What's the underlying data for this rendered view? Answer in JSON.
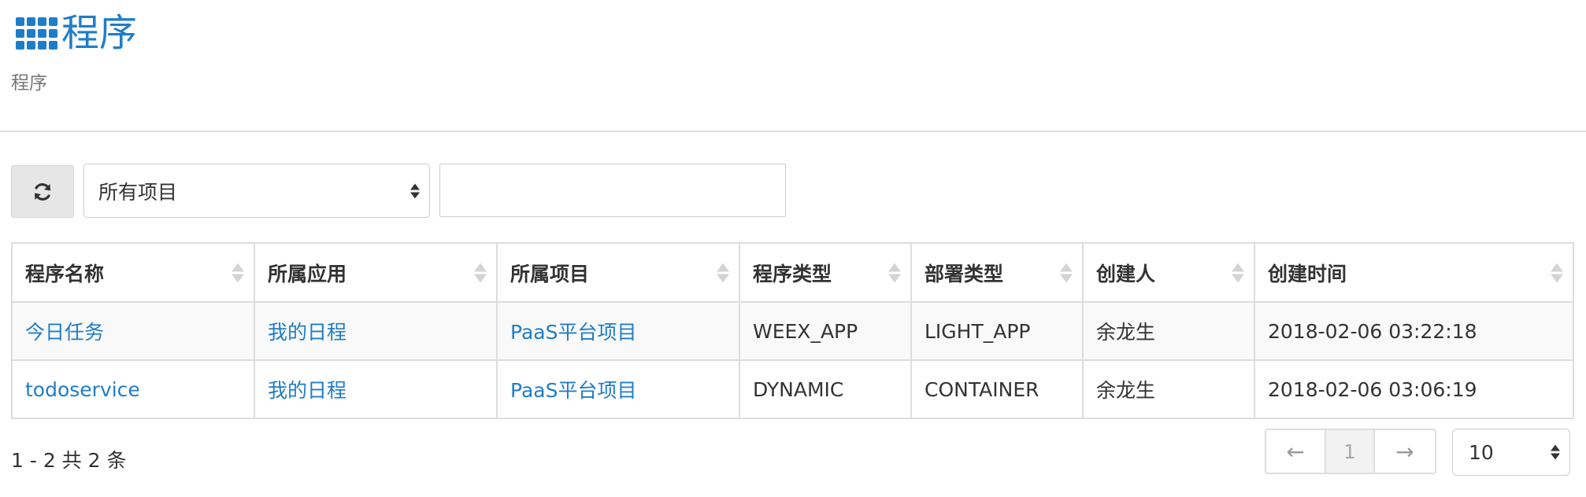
{
  "header": {
    "icon": "grid-icon",
    "title": "程序",
    "subtitle": "程序",
    "accent_color": "#1f7dc8"
  },
  "toolbar": {
    "refresh_icon": "refresh-icon",
    "project_filter": {
      "selected": "所有项目"
    },
    "search": {
      "value": "",
      "placeholder": ""
    }
  },
  "table": {
    "columns": [
      {
        "label": "程序名称"
      },
      {
        "label": "所属应用"
      },
      {
        "label": "所属项目"
      },
      {
        "label": "程序类型"
      },
      {
        "label": "部署类型"
      },
      {
        "label": "创建人"
      },
      {
        "label": "创建时间"
      }
    ],
    "rows": [
      {
        "name": "今日任务",
        "app": "我的日程",
        "project": "PaaS平台项目",
        "program_type": "WEEX_APP",
        "deploy_type": "LIGHT_APP",
        "creator": "余龙生",
        "created_at": "2018-02-06 03:22:18"
      },
      {
        "name": "todoservice",
        "app": "我的日程",
        "project": "PaaS平台项目",
        "program_type": "DYNAMIC",
        "deploy_type": "CONTAINER",
        "creator": "余龙生",
        "created_at": "2018-02-06 03:06:19"
      }
    ]
  },
  "footer": {
    "summary": "1 - 2 共 2 条",
    "pagination": {
      "prev": "←",
      "current": "1",
      "next": "→"
    },
    "page_size": "10"
  }
}
